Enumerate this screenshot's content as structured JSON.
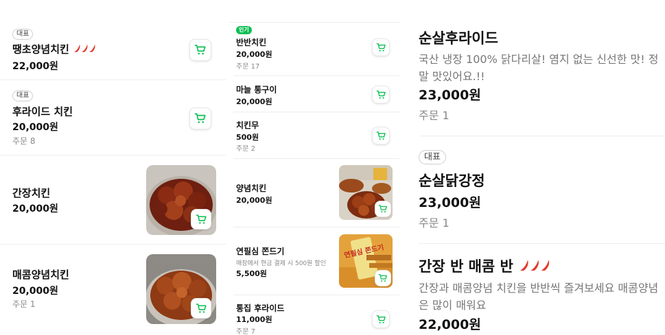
{
  "labels": {
    "rep_badge": "대표",
    "popular_badge": "인기"
  },
  "panel_left": {
    "items": [
      {
        "badge": "대표",
        "name": "땡초양념치킨",
        "spicy": 3,
        "price": "22,000원",
        "orders": ""
      },
      {
        "badge": "대표",
        "name": "후라이드 치킨",
        "spicy": 0,
        "price": "20,000원",
        "orders": "주문 8"
      },
      {
        "badge": "",
        "name": "간장치킨",
        "spicy": 0,
        "price": "20,000원",
        "orders": "",
        "photo": "soy-chicken-photo"
      },
      {
        "badge": "",
        "name": "매콤양념치킨",
        "spicy": 0,
        "price": "20,000원",
        "orders": "주문 1",
        "photo": "spicy-chicken-photo"
      }
    ]
  },
  "panel_middle": {
    "items": [
      {
        "badge": "인기",
        "name": "반반치킨",
        "price": "20,000원",
        "orders": "주문 17"
      },
      {
        "name": "마늘 통구이",
        "price": "20,000원",
        "orders": ""
      },
      {
        "name": "치킨무",
        "price": "500원",
        "orders": "주문 2"
      },
      {
        "name": "양념치킨",
        "price": "20,000원",
        "orders": "",
        "photo": "yangnyeom-chicken-photo"
      },
      {
        "name": "연필심 쫀드기",
        "sub": "매장에서 현금 결제 시 500원 할인",
        "price": "5,500원",
        "orders": "",
        "photo": "jjondeugi-snack-photo",
        "photo_text": "연필심 쫀드기"
      },
      {
        "name": "통집 후라이드",
        "price": "11,000원",
        "orders": "주문 7"
      }
    ]
  },
  "panel_right": {
    "items": [
      {
        "badge": "",
        "name": "순살후라이드",
        "desc": "국산 냉장 100% 닭다리살! 염지 없는 신선한 맛! 정말 맛있어요.!!",
        "price": "23,000원",
        "orders": "주문 1"
      },
      {
        "badge": "대표",
        "name": "순살닭강정",
        "desc": "",
        "price": "23,000원",
        "orders": "주문 1"
      },
      {
        "badge": "",
        "name": "간장 반 매콤 반",
        "spicy": 3,
        "desc": "간장과 매콤양념 치킨을 반반씩 즐겨보세요 매콤양념은 많이 매워요",
        "price": "22,000원",
        "orders": ""
      }
    ]
  },
  "colors": {
    "accent_green": "#0bbf53",
    "chili_red": "#e23b2e"
  },
  "icons": {
    "cart": "cart-icon",
    "chili": "chili-icon"
  }
}
